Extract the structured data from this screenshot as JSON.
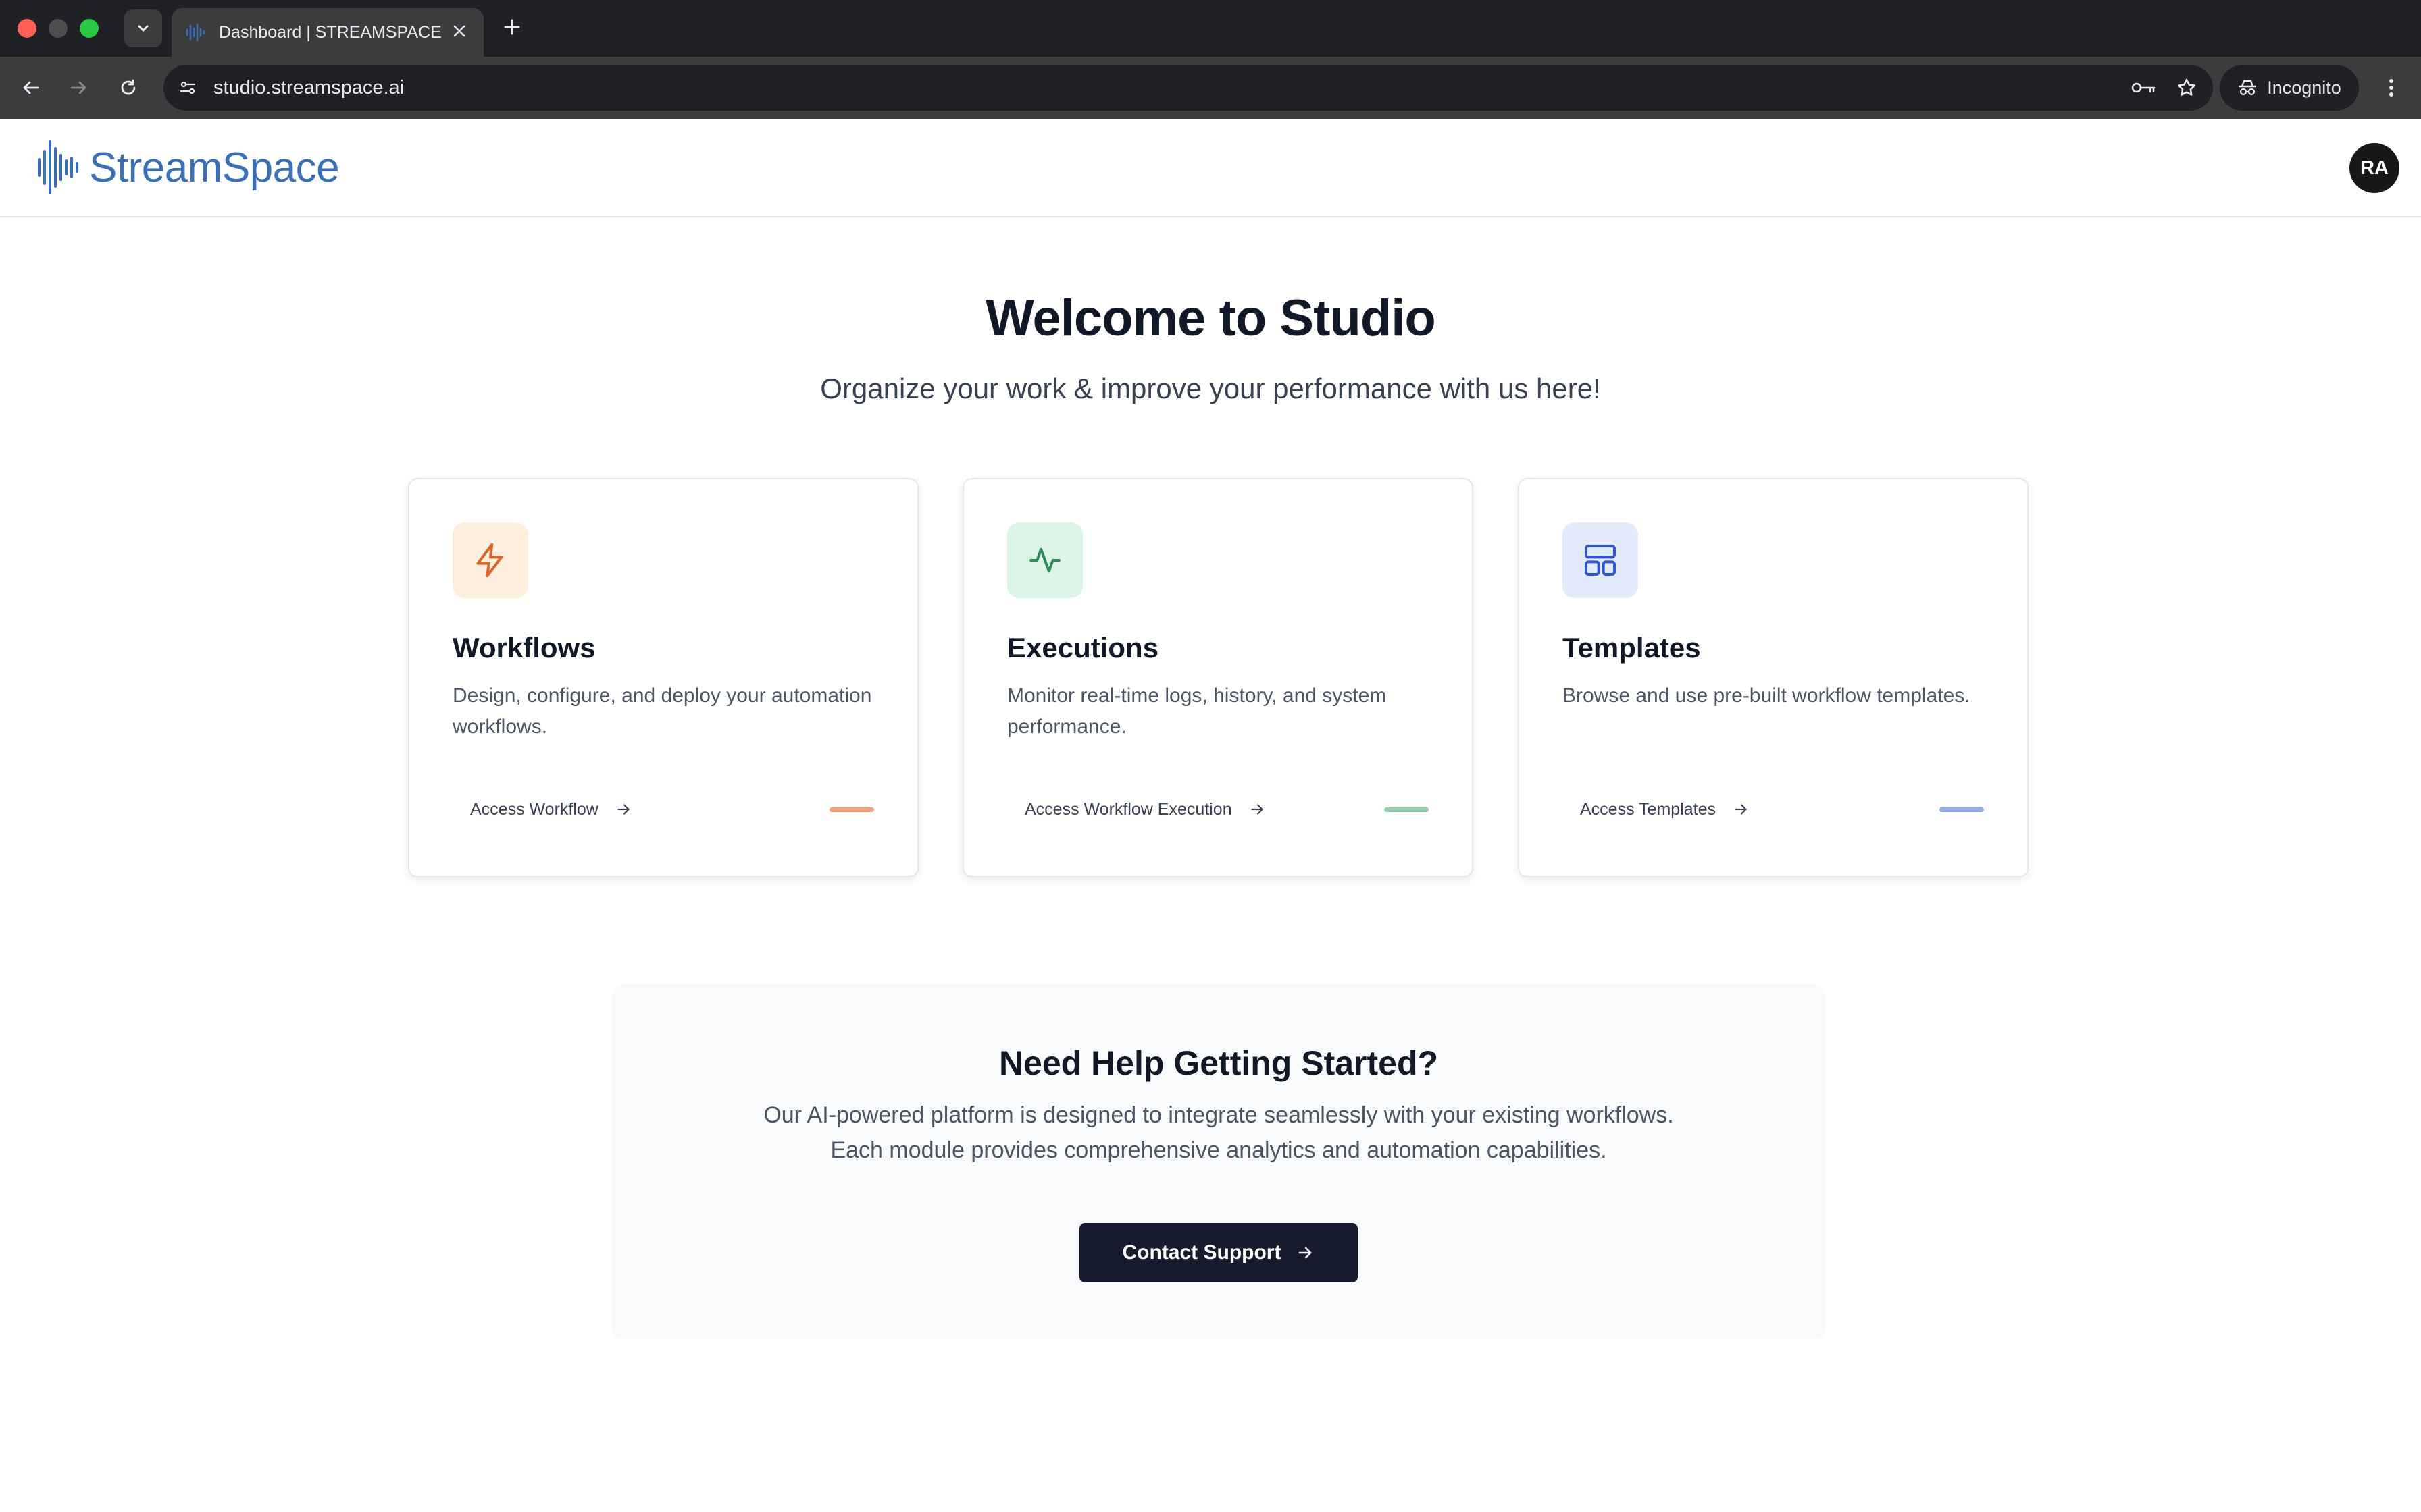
{
  "browser": {
    "tab_title": "Dashboard | STREAMSPACE",
    "url": "studio.streamspace.ai",
    "incognito_label": "Incognito",
    "icons": [
      "tab-search-icon",
      "close-icon",
      "plus-icon",
      "back-icon",
      "forward-icon",
      "reload-icon",
      "site-info-icon",
      "password-key-icon",
      "star-icon",
      "incognito-icon",
      "kebab-menu-icon"
    ]
  },
  "header": {
    "brand": "StreamSpace",
    "avatar_initials": "RA",
    "brand_color": "#3a6fb5"
  },
  "hero": {
    "title": "Welcome to Studio",
    "subtitle": "Organize your work & improve your performance with us here!"
  },
  "cards": [
    {
      "title": "Workflows",
      "description": "Design, configure, and deploy your automation workflows.",
      "link": "Access Workflow",
      "icon": "lightning-icon",
      "accent": "#f0a07a",
      "icon_bg": "#fdeede",
      "icon_color": "#d9642c"
    },
    {
      "title": "Executions",
      "description": "Monitor real-time logs, history, and system performance.",
      "link": "Access Workflow Execution",
      "icon": "activity-icon",
      "accent": "#8fcfad",
      "icon_bg": "#dcf5e6",
      "icon_color": "#2f8a5a"
    },
    {
      "title": "Templates",
      "description": "Browse and use pre-built workflow templates.",
      "link": "Access Templates",
      "icon": "layout-icon",
      "accent": "#93a9f0",
      "icon_bg": "#e2eafc",
      "icon_color": "#3056d3"
    }
  ],
  "help": {
    "title": "Need Help Getting Started?",
    "description": "Our AI-powered platform is designed to integrate seamlessly with your existing workflows. Each module provides comprehensive analytics and automation capabilities.",
    "button": "Contact Support"
  }
}
